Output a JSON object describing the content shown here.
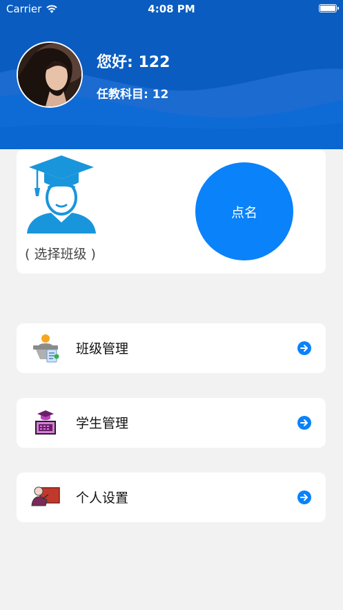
{
  "status_bar": {
    "carrier": "Carrier",
    "time": "4:08 PM"
  },
  "header": {
    "greeting": "您好: 122",
    "subject": "任教科目: 12"
  },
  "rollcall_card": {
    "select_class": "( 选择班级 )",
    "rollcall_label": "点名"
  },
  "menu": [
    {
      "label": "班级管理",
      "icon": "class-management-icon"
    },
    {
      "label": "学生管理",
      "icon": "student-management-icon"
    },
    {
      "label": "个人设置",
      "icon": "personal-settings-icon"
    }
  ],
  "colors": {
    "header_blue": "#0a5cc0",
    "accent_blue": "#0a82fa",
    "background": "#f2f2f2"
  }
}
